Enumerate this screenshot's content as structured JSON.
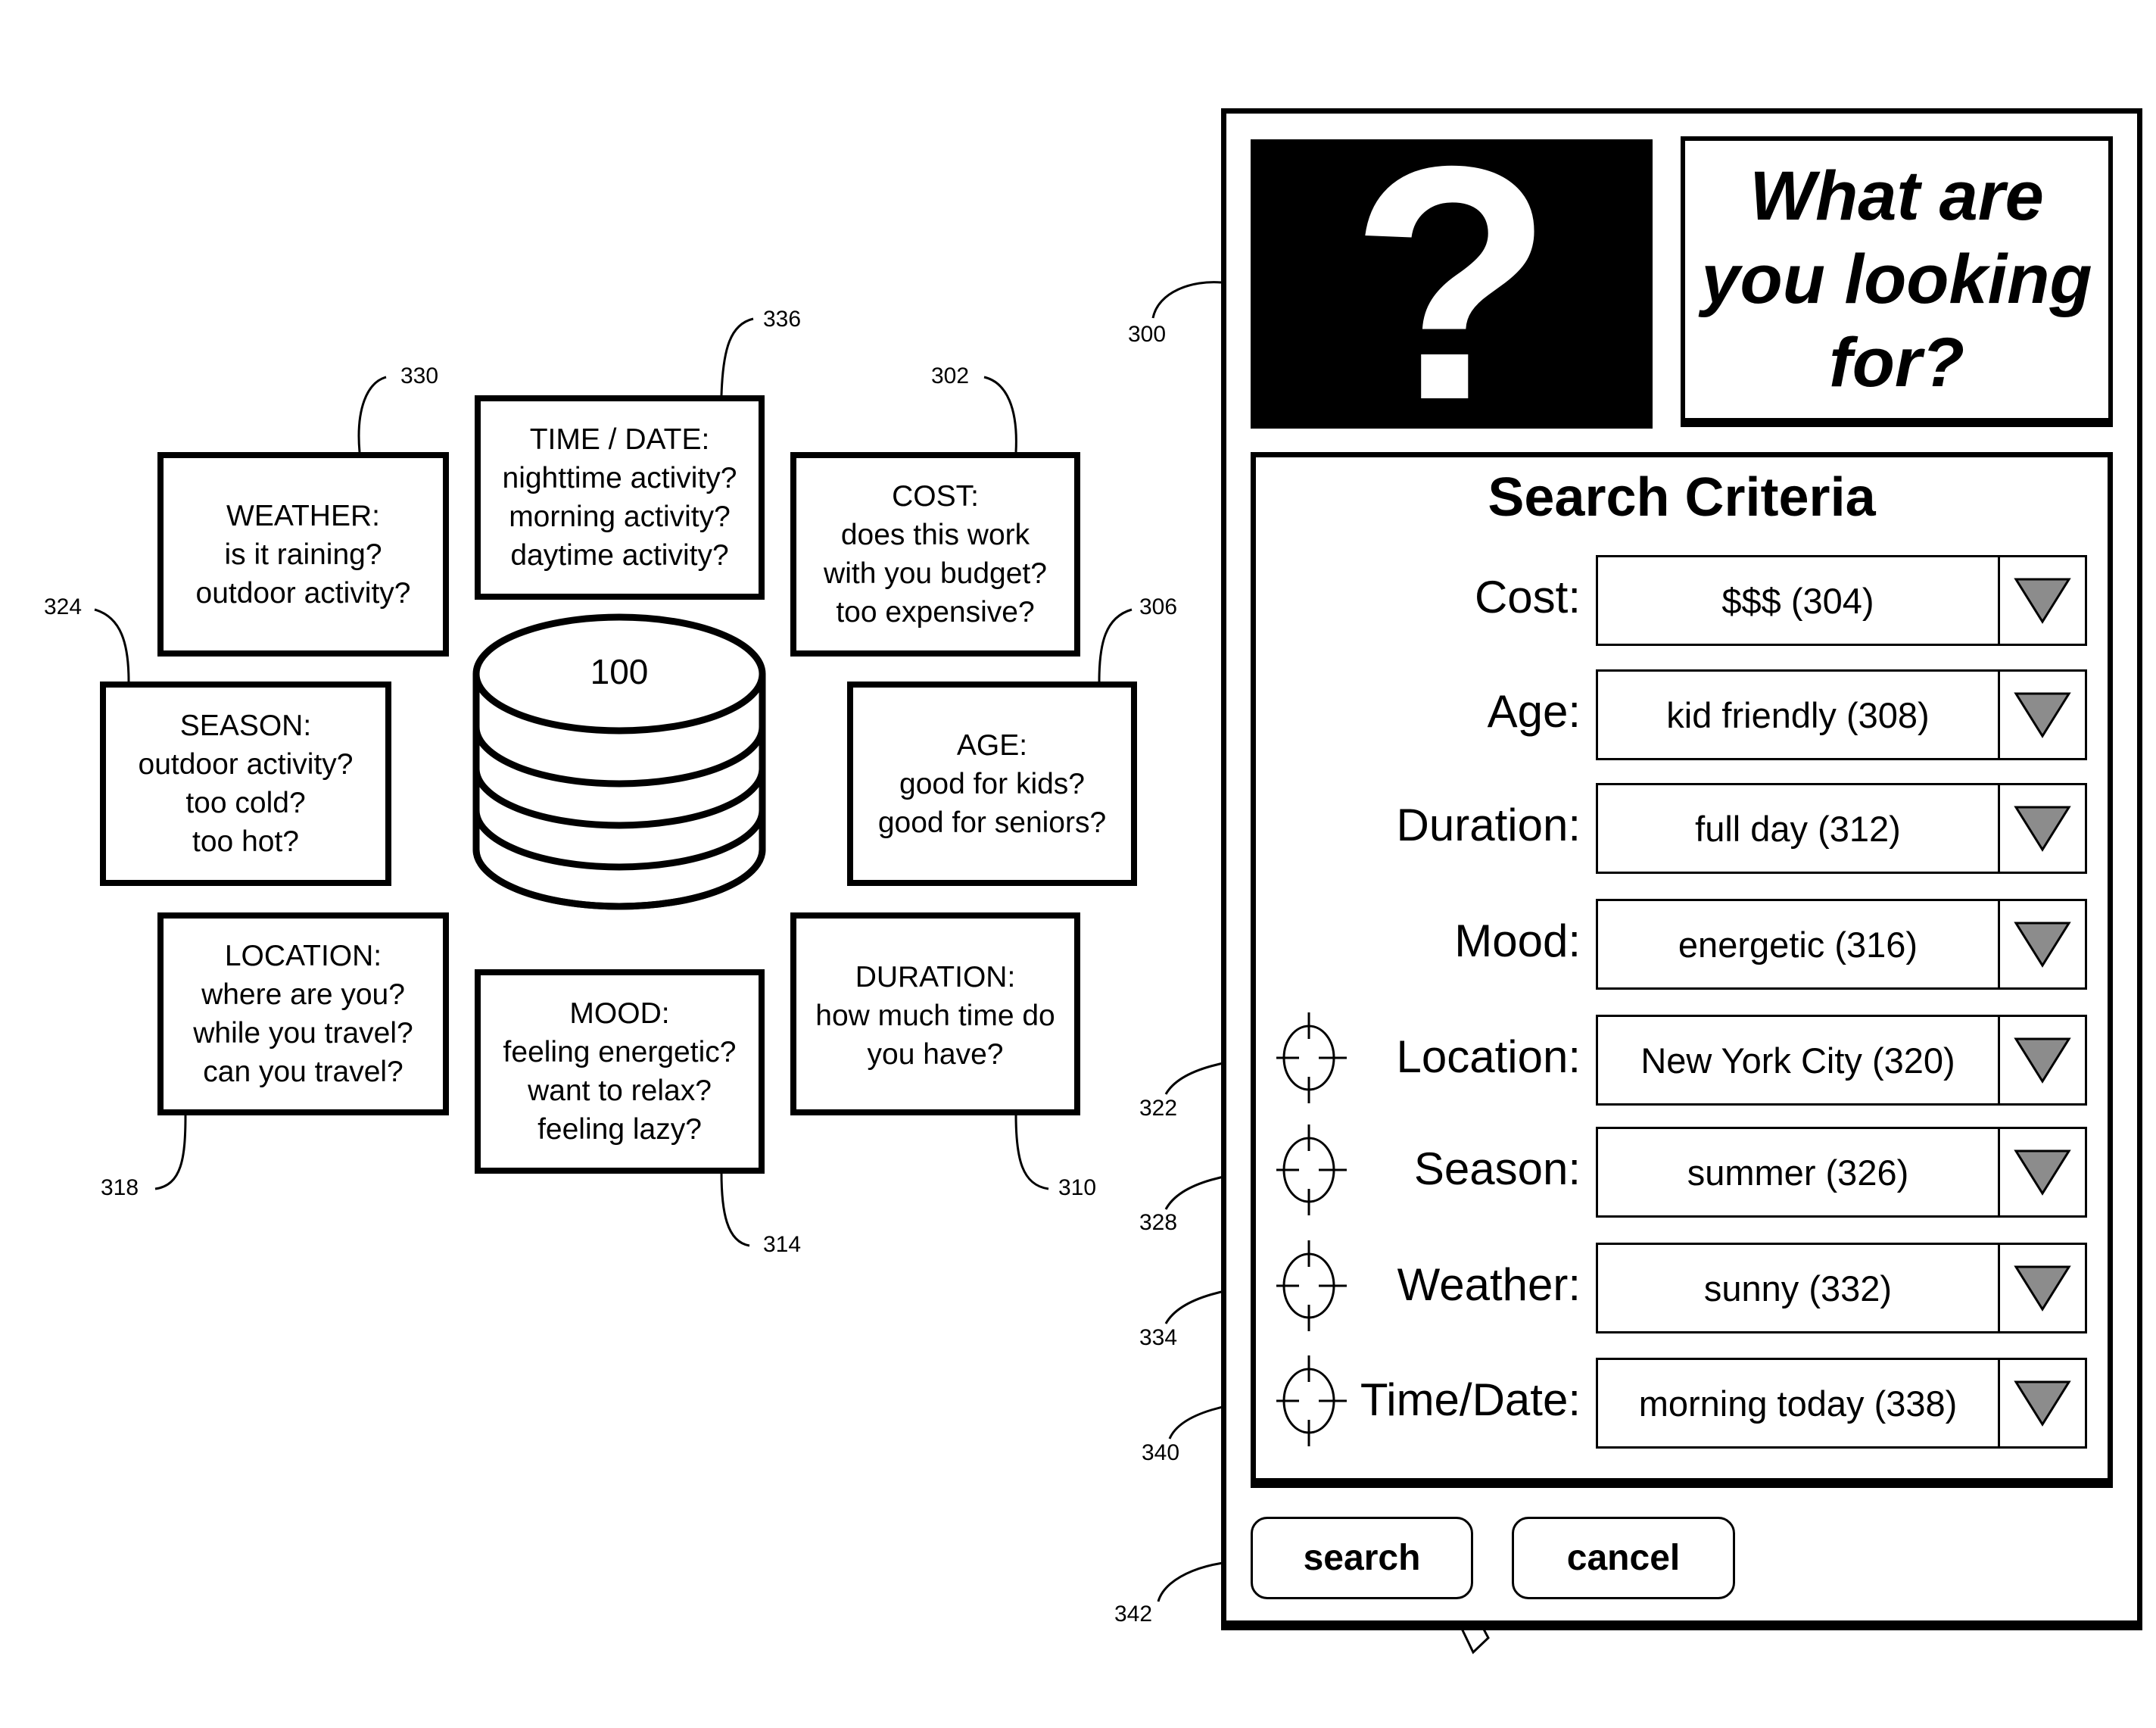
{
  "diagram": {
    "center_store": {
      "label": "100"
    },
    "categories": [
      {
        "id": "weather",
        "ref": "330",
        "title": "WEATHER:",
        "lines": [
          "is it raining?",
          "outdoor activity?"
        ]
      },
      {
        "id": "time-date",
        "ref": "336",
        "title": "TIME / DATE:",
        "lines": [
          "nighttime activity?",
          "morning activity?",
          "daytime activity?"
        ]
      },
      {
        "id": "cost",
        "ref": "302",
        "title": "COST:",
        "lines": [
          "does this work",
          "with you budget?",
          "too expensive?"
        ]
      },
      {
        "id": "season",
        "ref": "324",
        "title": "SEASON:",
        "lines": [
          "outdoor activity?",
          "too cold?",
          "too hot?"
        ]
      },
      {
        "id": "age",
        "ref": "306",
        "title": "AGE:",
        "lines": [
          "good for kids?",
          "good for seniors?"
        ]
      },
      {
        "id": "location",
        "ref": "318",
        "title": "LOCATION:",
        "lines": [
          "where are you?",
          "while you travel?",
          "can you travel?"
        ]
      },
      {
        "id": "mood",
        "ref": "314",
        "title": "MOOD:",
        "lines": [
          "feeling energetic?",
          "want to relax?",
          "feeling lazy?"
        ]
      },
      {
        "id": "duration",
        "ref": "310",
        "title": "DURATION:",
        "lines": [
          "how much time do",
          "you have?"
        ]
      }
    ]
  },
  "panel": {
    "ref": "300",
    "icon": "question-mark-icon",
    "question_glyph": "?",
    "title_lines": [
      "What are",
      "you looking",
      "for?"
    ],
    "criteria_title": "Search Criteria",
    "criteria": [
      {
        "label": "Cost:",
        "value": "$$$ (304)",
        "locate_icon": false
      },
      {
        "label": "Age:",
        "value": "kid friendly (308)",
        "locate_icon": false
      },
      {
        "label": "Duration:",
        "value": "full day (312)",
        "locate_icon": false
      },
      {
        "label": "Mood:",
        "value": "energetic (316)",
        "locate_icon": false
      },
      {
        "label": "Location:",
        "value": "New York City (320)",
        "locate_icon": true,
        "icon_ref": "322"
      },
      {
        "label": "Season:",
        "value": "summer (326)",
        "locate_icon": true,
        "icon_ref": "328"
      },
      {
        "label": "Weather:",
        "value": "sunny (332)",
        "locate_icon": true,
        "icon_ref": "334"
      },
      {
        "label": "Time/Date:",
        "value": "morning today (338)",
        "locate_icon": true,
        "icon_ref": "340"
      }
    ],
    "buttons": {
      "search": "search",
      "cancel": "cancel",
      "search_ref": "342"
    },
    "arrow_fill": "#8c8c8c"
  }
}
